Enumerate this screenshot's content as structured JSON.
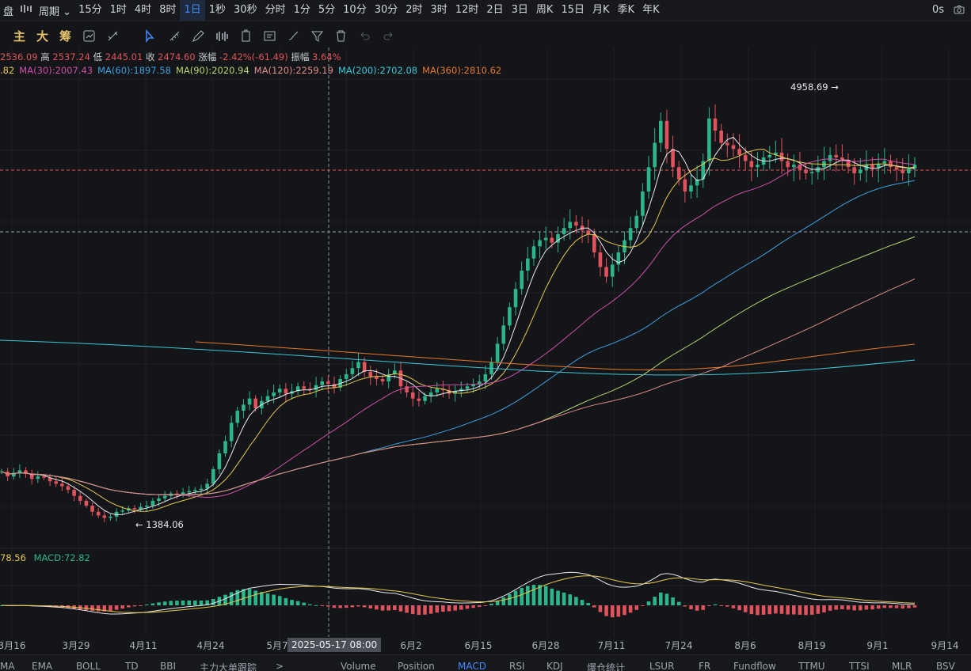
{
  "topbar": {
    "left_label": "盘",
    "period_label": "周期",
    "items": [
      "15分",
      "1时",
      "4时",
      "8时",
      "1日",
      "1秒",
      "30秒",
      "分时",
      "1分",
      "5分",
      "10分",
      "30分",
      "2时",
      "3时",
      "12时",
      "2日",
      "3日",
      "周K",
      "15日",
      "月K",
      "季K",
      "年K"
    ],
    "active": "1日",
    "right_label": "0s"
  },
  "toolbar": {
    "indicators": [
      "主",
      "大",
      "筹"
    ]
  },
  "ohlc": {
    "open_val": "2536.09",
    "high_label": "高",
    "high_val": "2537.24",
    "low_label": "低",
    "low_val": "2445.01",
    "close_label": "收",
    "close_val": "2474.60",
    "chg_label": "涨幅",
    "chg_val": "-2.42%(-61.49)",
    "amp_label": "振幅",
    "amp_val": "3.64%"
  },
  "ma_legend": [
    {
      "text": ".82",
      "color": "#e6c84a"
    },
    {
      "text": "MA(30):2007.43",
      "color": "#d14fa8"
    },
    {
      "text": "MA(60):1897.58",
      "color": "#3aa0e0"
    },
    {
      "text": "MA(90):2020.94",
      "color": "#b8d46a"
    },
    {
      "text": "MA(120):2259.19",
      "color": "#e08a8a"
    },
    {
      "text": "MA(200):2702.08",
      "color": "#38c8d8"
    },
    {
      "text": "MA(360):2810.62",
      "color": "#e8782c"
    }
  ],
  "annotations": {
    "high": "4958.69",
    "low": "1384.06"
  },
  "macd_legend": {
    "dea": "78.56",
    "macd": "MACD:72.82"
  },
  "x_axis": [
    "3月16",
    "3月29",
    "4月11",
    "4月24",
    "5月7",
    "6月2",
    "6月15",
    "6月28",
    "7月11",
    "7月24",
    "8月6",
    "8月19",
    "9月1",
    "9月14"
  ],
  "crosshair_label": "2025-05-17 08:00",
  "bottom_tabs": [
    "MA",
    "EMA",
    "BOLL",
    "TD",
    "BBI",
    "主力大单跟踪",
    ">",
    "Volume",
    "Position",
    "MACD",
    "RSI",
    "KDJ",
    "爆仓统计",
    "LSUR",
    "FR",
    "Fundflow",
    "TTMU",
    "TTSI",
    "MLR",
    "BSV"
  ],
  "bottom_active": "MACD",
  "colors": {
    "up": "#2bb68a",
    "down": "#e0525c",
    "bg": "#141518",
    "accent": "#3f8cff"
  },
  "chart_data": {
    "type": "candlestick",
    "series_close": [
      1800,
      1760,
      1790,
      1810,
      1780,
      1740,
      1760,
      1750,
      1720,
      1700,
      1680,
      1650,
      1600,
      1560,
      1520,
      1470,
      1440,
      1420,
      1430,
      1470,
      1480,
      1500,
      1490,
      1510,
      1520,
      1560,
      1580,
      1600,
      1620,
      1610,
      1630,
      1640,
      1650,
      1660,
      1700,
      1820,
      1950,
      2050,
      2200,
      2300,
      2350,
      2400,
      2320,
      2380,
      2420,
      2450,
      2480,
      2440,
      2460,
      2500,
      2480,
      2470,
      2510,
      2540,
      2520,
      2490,
      2560,
      2600,
      2650,
      2700,
      2620,
      2580,
      2560,
      2540,
      2600,
      2630,
      2500,
      2450,
      2400,
      2380,
      2420,
      2450,
      2480,
      2470,
      2440,
      2460,
      2480,
      2500,
      2520,
      2540,
      2600,
      2700,
      2850,
      3000,
      3150,
      3300,
      3450,
      3550,
      3650,
      3700,
      3720,
      3680,
      3750,
      3800,
      3850,
      3820,
      3780,
      3750,
      3600,
      3480,
      3400,
      3500,
      3600,
      3700,
      3800,
      3900,
      4100,
      4300,
      4500,
      4680,
      4450,
      4300,
      4200,
      4100,
      4150,
      4200,
      4350,
      4700,
      4600,
      4500,
      4480,
      4450,
      4400,
      4350,
      4300,
      4320,
      4380,
      4400,
      4420,
      4350,
      4300,
      4320,
      4280,
      4250,
      4260,
      4300,
      4350,
      4400,
      4380,
      4360,
      4300,
      4250,
      4280,
      4320,
      4290,
      4330,
      4350,
      4300,
      4280,
      4250,
      4290,
      4320
    ]
  }
}
